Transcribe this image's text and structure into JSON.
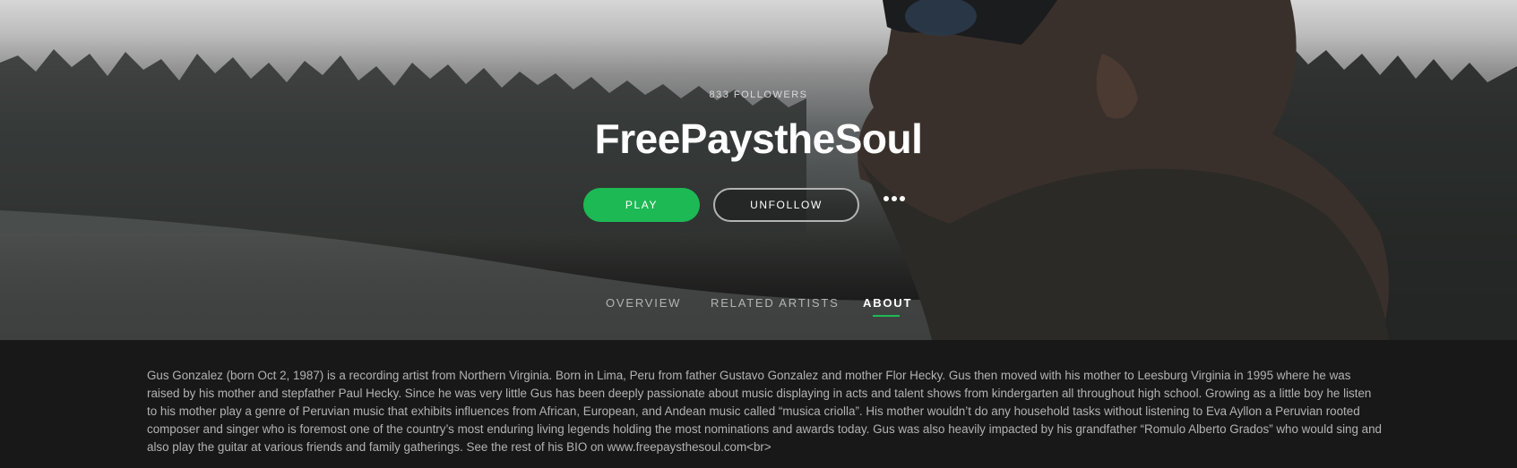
{
  "artist": {
    "followers": "833 FOLLOWERS",
    "name": "FreePaystheSoul"
  },
  "actions": {
    "play_label": "PLAY",
    "unfollow_label": "UNFOLLOW",
    "more_label": "•••",
    "more_icon": "more-options-icon"
  },
  "tabs": [
    {
      "label": "OVERVIEW",
      "active": false
    },
    {
      "label": "RELATED ARTISTS",
      "active": false
    },
    {
      "label": "ABOUT",
      "active": true
    }
  ],
  "about": {
    "bio": "Gus Gonzalez (born Oct 2, 1987) is a recording artist from Northern Virginia. Born in Lima, Peru from father Gustavo Gonzalez and mother Flor Hecky. Gus then moved with his mother to Leesburg Virginia in 1995 where he was raised by his mother and stepfather Paul Hecky. Since he was very little Gus has been deeply passionate about music displaying in acts and talent shows from kindergarten all throughout high school. Growing as a little boy he listen to his mother play a genre of Peruvian music that exhibits influences from African, European, and Andean music called “musica criolla”. His mother wouldn’t do any household tasks without listening to Eva Ayllon a Peruvian rooted composer and singer who is foremost one of the country’s most enduring living legends holding the most nominations and awards today. Gus was also heavily impacted by his grandfather “Romulo Alberto Grados” who would sing and also play the guitar at various friends and family gatherings. See the rest of his BIO on www.freepaysthesoul.com<br>"
  },
  "colors": {
    "accent": "#1db954",
    "background": "#181818",
    "text_muted": "#b3b3b3"
  }
}
